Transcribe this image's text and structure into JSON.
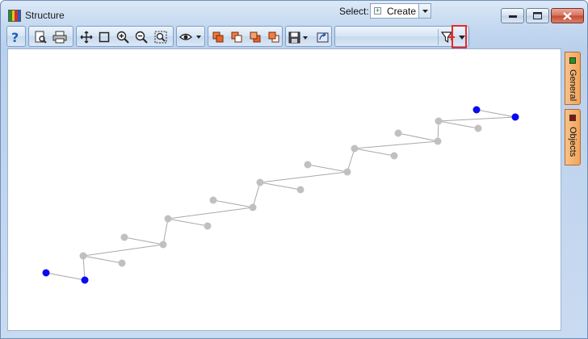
{
  "window": {
    "title": "Structure",
    "controls": {
      "minimize": "minimize-icon",
      "maximize": "maximize-icon",
      "close": "close-icon"
    }
  },
  "toolbar": {
    "select_label": "Select:",
    "select_value": "Create",
    "buttons": [
      "help-icon",
      "print-preview-icon",
      "print-icon",
      "move-icon",
      "select-rect-icon",
      "zoom-in-icon",
      "zoom-out-icon",
      "zoom-fit-icon",
      "view-icon",
      "layer-1-icon",
      "layer-2-icon",
      "layer-3-icon",
      "layer-4-icon",
      "save-icon",
      "export-icon",
      "filter-icon"
    ]
  },
  "side_tabs": [
    {
      "label": "General",
      "color": "#1a9a1a"
    },
    {
      "label": "Objects",
      "color": "#8a1010"
    }
  ],
  "graph": {
    "node_color_gray": "#c0c0c0",
    "node_color_blue": "#0a0af0",
    "edge_color": "#a8a8a8"
  }
}
